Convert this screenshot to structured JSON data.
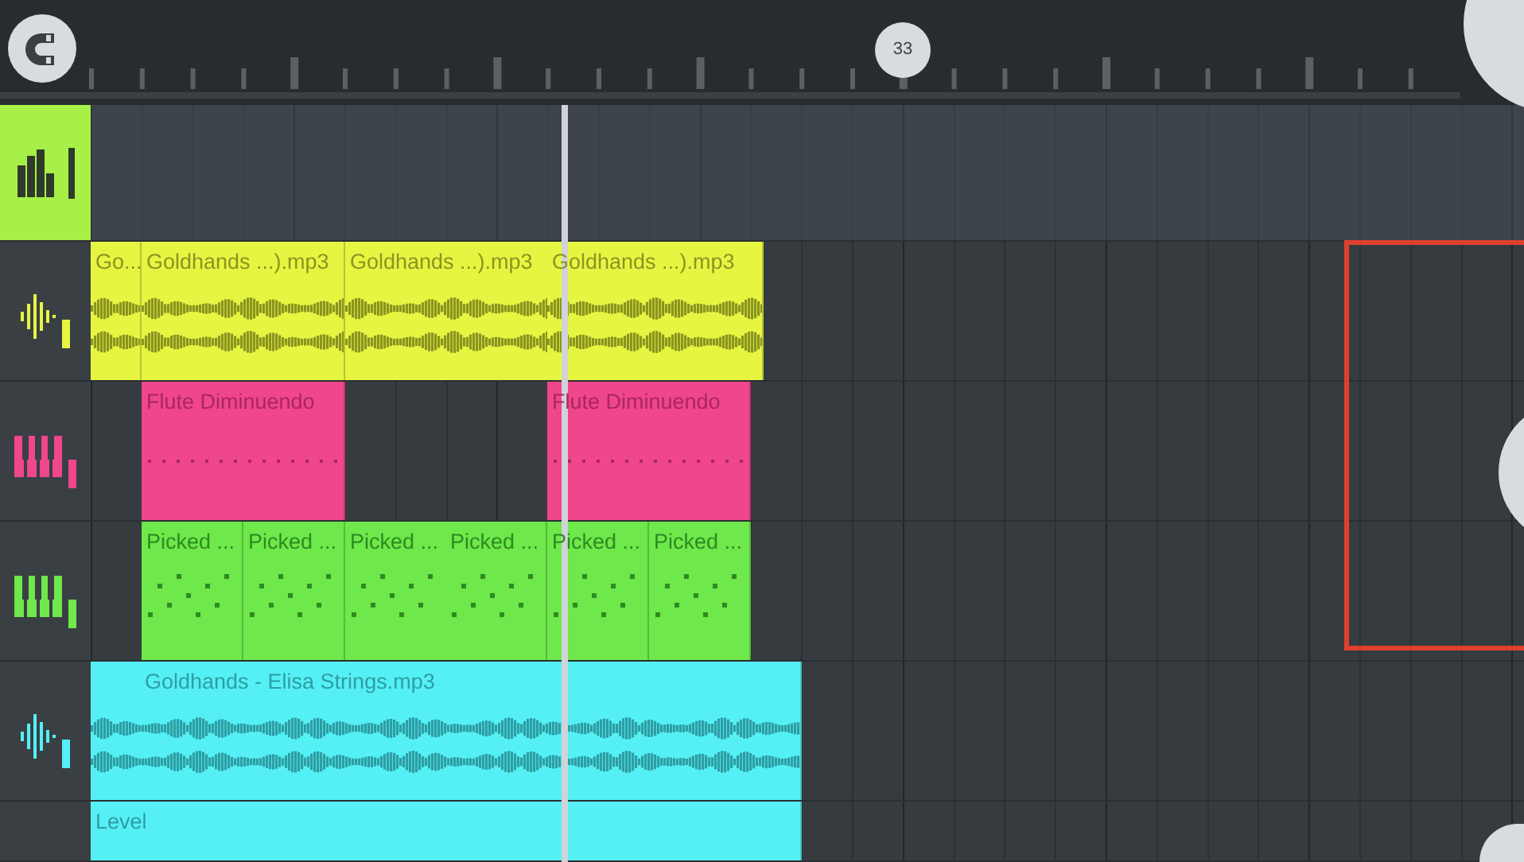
{
  "ruler": {
    "playhead_marker": "33"
  },
  "master_track": {
    "selected": true
  },
  "tracks": [
    {
      "kind": "audio",
      "color": "#e6f542",
      "clips": [
        {
          "label": "Go..."
        },
        {
          "label": "Goldhands ...).mp3"
        },
        {
          "label": "Goldhands ...).mp3"
        },
        {
          "label": "Goldhands ...).mp3"
        }
      ]
    },
    {
      "kind": "pattern",
      "color": "#f0468c",
      "clips": [
        {
          "label": "Flute Diminuendo"
        },
        {
          "label": "Flute Diminuendo"
        }
      ]
    },
    {
      "kind": "pattern",
      "color": "#6ee84a",
      "clips": [
        {
          "label": "Picked ..."
        },
        {
          "label": "Picked ..."
        },
        {
          "label": "Picked ..."
        },
        {
          "label": "Picked ..."
        },
        {
          "label": "Picked ..."
        },
        {
          "label": "Picked ..."
        }
      ]
    },
    {
      "kind": "audio",
      "color": "#55f0f5",
      "clips": [
        {
          "label": "Goldhands - Elisa Strings.mp3"
        }
      ]
    },
    {
      "kind": "automation",
      "color": "#55f0f5",
      "clips": [
        {
          "label": "Level"
        }
      ]
    }
  ]
}
